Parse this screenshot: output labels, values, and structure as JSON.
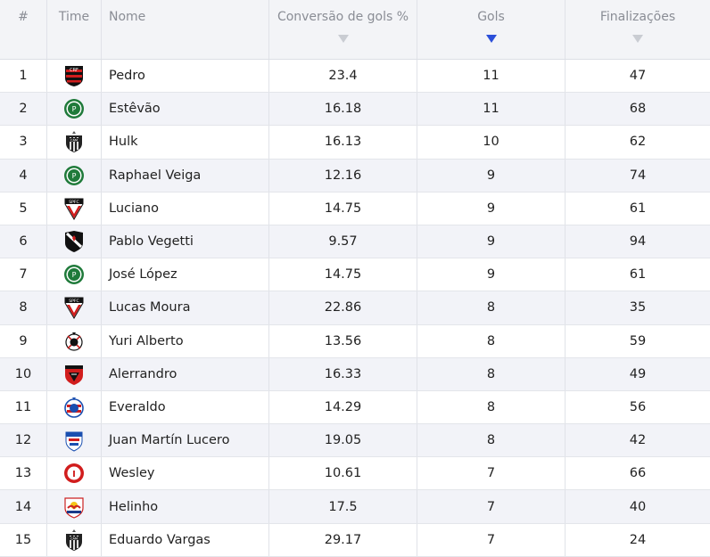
{
  "header": {
    "rank": "#",
    "team": "Time",
    "name": "Nome",
    "conversion": "Conversão de gols %",
    "goals": "Gols",
    "shots": "Finalizações"
  },
  "colors": {
    "sort_active": "#2b4fd9",
    "sort_inactive": "#c9ccd2"
  },
  "rows": [
    {
      "rank": "1",
      "team_icon": "flamengo-badge-icon",
      "name": "Pedro",
      "conversion": "23.4",
      "goals": "11",
      "shots": "47"
    },
    {
      "rank": "2",
      "team_icon": "palmeiras-badge-icon",
      "name": "Estêvão",
      "conversion": "16.18",
      "goals": "11",
      "shots": "68"
    },
    {
      "rank": "3",
      "team_icon": "atletico-mg-badge-icon",
      "name": "Hulk",
      "conversion": "16.13",
      "goals": "10",
      "shots": "62"
    },
    {
      "rank": "4",
      "team_icon": "palmeiras-badge-icon",
      "name": "Raphael Veiga",
      "conversion": "12.16",
      "goals": "9",
      "shots": "74"
    },
    {
      "rank": "5",
      "team_icon": "sao-paulo-badge-icon",
      "name": "Luciano",
      "conversion": "14.75",
      "goals": "9",
      "shots": "61"
    },
    {
      "rank": "6",
      "team_icon": "vasco-badge-icon",
      "name": "Pablo Vegetti",
      "conversion": "9.57",
      "goals": "9",
      "shots": "94"
    },
    {
      "rank": "7",
      "team_icon": "palmeiras-badge-icon",
      "name": "José López",
      "conversion": "14.75",
      "goals": "9",
      "shots": "61"
    },
    {
      "rank": "8",
      "team_icon": "sao-paulo-badge-icon",
      "name": "Lucas Moura",
      "conversion": "22.86",
      "goals": "8",
      "shots": "35"
    },
    {
      "rank": "9",
      "team_icon": "corinthians-badge-icon",
      "name": "Yuri Alberto",
      "conversion": "13.56",
      "goals": "8",
      "shots": "59"
    },
    {
      "rank": "10",
      "team_icon": "vitoria-badge-icon",
      "name": "Alerrandro",
      "conversion": "16.33",
      "goals": "8",
      "shots": "49"
    },
    {
      "rank": "11",
      "team_icon": "bahia-badge-icon",
      "name": "Everaldo",
      "conversion": "14.29",
      "goals": "8",
      "shots": "56"
    },
    {
      "rank": "12",
      "team_icon": "fortaleza-badge-icon",
      "name": "Juan Martín Lucero",
      "conversion": "19.05",
      "goals": "8",
      "shots": "42"
    },
    {
      "rank": "13",
      "team_icon": "internacional-badge-icon",
      "name": "Wesley",
      "conversion": "10.61",
      "goals": "7",
      "shots": "66"
    },
    {
      "rank": "14",
      "team_icon": "bragantino-badge-icon",
      "name": "Helinho",
      "conversion": "17.5",
      "goals": "7",
      "shots": "40"
    },
    {
      "rank": "15",
      "team_icon": "atletico-mg-badge-icon",
      "name": "Eduardo Vargas",
      "conversion": "29.17",
      "goals": "7",
      "shots": "24"
    }
  ]
}
